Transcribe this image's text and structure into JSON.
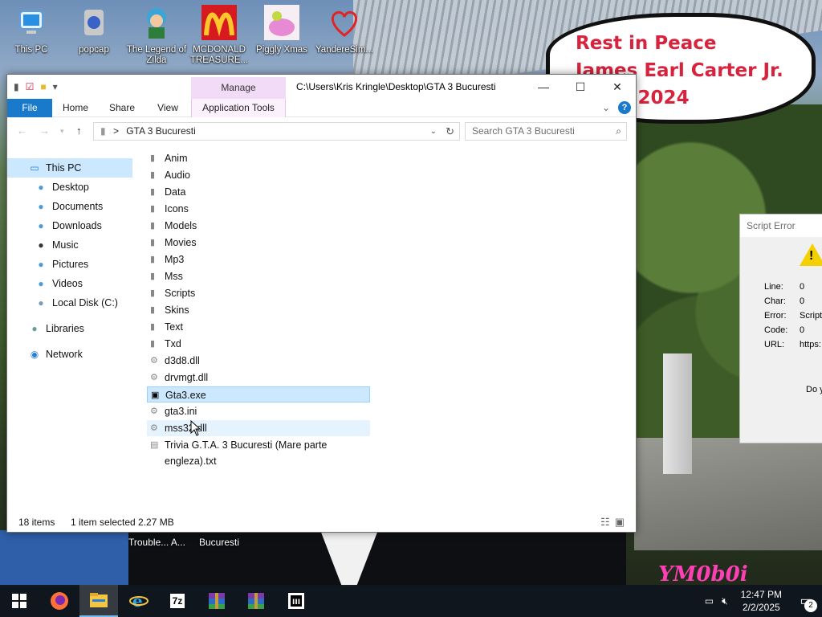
{
  "wallpaper": {
    "rip_line1": "Rest in Peace",
    "rip_line2": "James Earl Carter Jr.",
    "rip_line3": "- 2024",
    "logo": "YM0b0i"
  },
  "desktop_icons": [
    {
      "label": "This PC",
      "icon": "monitor-icon"
    },
    {
      "label": "popcap",
      "icon": "popcap-icon"
    },
    {
      "label": "The Legend of Zilda",
      "icon": "zilda-icon"
    },
    {
      "label": "MCDONALD TREASURE...",
      "icon": "mcdonalds-icon"
    },
    {
      "label": "Piggly Xmas",
      "icon": "pig-icon"
    },
    {
      "label": "YandereSim...",
      "icon": "heart-icon"
    }
  ],
  "explorer": {
    "manage_tab": "Manage",
    "title": "C:\\Users\\Kris Kringle\\Desktop\\GTA 3 Bucuresti",
    "ribbon": {
      "file": "File",
      "home": "Home",
      "share": "Share",
      "view": "View",
      "app_tools": "Application Tools"
    },
    "address": {
      "separator": ">",
      "folder": "GTA 3 Bucuresti"
    },
    "search_placeholder": "Search GTA 3 Bucuresti",
    "nav": [
      {
        "label": "This PC",
        "icon": "computer-icon"
      },
      {
        "label": "Desktop",
        "icon": "desktop-icon"
      },
      {
        "label": "Documents",
        "icon": "documents-icon"
      },
      {
        "label": "Downloads",
        "icon": "downloads-icon"
      },
      {
        "label": "Music",
        "icon": "music-icon"
      },
      {
        "label": "Pictures",
        "icon": "pictures-icon"
      },
      {
        "label": "Videos",
        "icon": "videos-icon"
      },
      {
        "label": "Local Disk (C:)",
        "icon": "disk-icon"
      },
      {
        "label": "Libraries",
        "icon": "libraries-icon"
      },
      {
        "label": "Network",
        "icon": "network-icon"
      }
    ],
    "files": [
      {
        "name": "Anim",
        "type": "folder"
      },
      {
        "name": "Audio",
        "type": "folder"
      },
      {
        "name": "Data",
        "type": "folder"
      },
      {
        "name": "Icons",
        "type": "folder"
      },
      {
        "name": "Models",
        "type": "folder"
      },
      {
        "name": "Movies",
        "type": "folder"
      },
      {
        "name": "Mp3",
        "type": "folder"
      },
      {
        "name": "Mss",
        "type": "folder"
      },
      {
        "name": "Scripts",
        "type": "folder"
      },
      {
        "name": "Skins",
        "type": "folder"
      },
      {
        "name": "Text",
        "type": "folder"
      },
      {
        "name": "Txd",
        "type": "folder"
      },
      {
        "name": "d3d8.dll",
        "type": "dll"
      },
      {
        "name": "drvmgt.dll",
        "type": "dll"
      },
      {
        "name": "Gta3.exe",
        "type": "exe"
      },
      {
        "name": "gta3.ini",
        "type": "ini"
      },
      {
        "name": "mss32.dll",
        "type": "dll"
      },
      {
        "name": "Trivia G.T.A. 3 Bucuresti (Mare parte engleza).txt",
        "type": "txt"
      }
    ],
    "status": {
      "count": "18 items",
      "selection": "1 item selected  2.27 MB"
    }
  },
  "script_error": {
    "title": "Script Error",
    "rows": [
      {
        "label": "Line:",
        "value": "0"
      },
      {
        "label": "Char:",
        "value": "0"
      },
      {
        "label": "Error:",
        "value": "Script"
      },
      {
        "label": "Code:",
        "value": "0"
      },
      {
        "label": "URL:",
        "value": "https:"
      }
    ],
    "question": "Do y"
  },
  "desktop_labels": {
    "left": "Trouble... A...",
    "right": "Bucuresti"
  },
  "taskbar": {
    "apps": [
      "start-icon",
      "firefox-icon",
      "file-explorer-icon",
      "internet-explorer-icon",
      "7zip-icon",
      "winrar-icon",
      "winrar-icon",
      "gta3-icon"
    ],
    "seven_zip_label": "7z",
    "time": "12:47 PM",
    "date": "2/2/2025",
    "notifications": "2"
  },
  "colors": {
    "accent": "#1979ca",
    "selection": "#cce8ff",
    "manage_tab": "#f2dbf6",
    "rip_text": "#d7233d"
  }
}
